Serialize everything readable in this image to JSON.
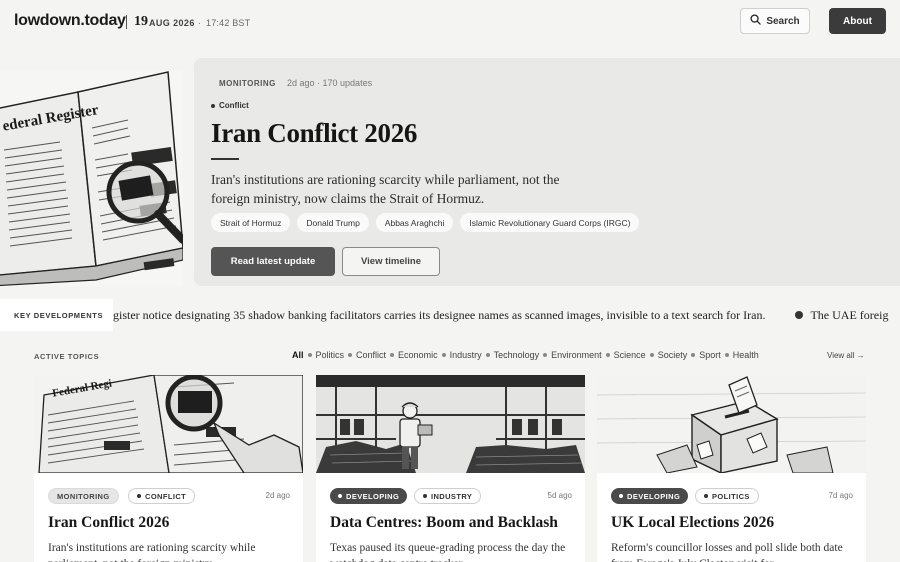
{
  "header": {
    "logo": "lowdown.today",
    "date_day": "19",
    "date_rest": "AUG 2026",
    "separator_dot": "·",
    "time": "17:42 BST",
    "search_label": "Search",
    "about_label": "About"
  },
  "hero": {
    "status": "MONITORING",
    "meta": "2d ago · 170 updates",
    "category": "Conflict",
    "title": "Iran Conflict 2026",
    "description": "Iran's institutions are rationing scarcity while parliament, not the foreign ministry, now claims the Strait of Hormuz.",
    "tags": [
      "Strait of Hormuz",
      "Donald Trump",
      "Abbas Araghchi",
      "Islamic Revolutionary Guard Corps (IRGC)"
    ],
    "primary_button": "Read latest update",
    "secondary_button": "View timeline"
  },
  "ticker": {
    "label": "KEY DEVELOPMENTS",
    "items": [
      "gister notice designating 35 shadow banking facilitators carries its designee names as scanned images, invisible to a text search for Iran.",
      "The UAE foreig"
    ]
  },
  "topics": {
    "label": "ACTIVE TOPICS",
    "filters": [
      "All",
      "Politics",
      "Conflict",
      "Economic",
      "Industry",
      "Technology",
      "Environment",
      "Science",
      "Society",
      "Sport",
      "Health"
    ],
    "active_filter": "All",
    "view_all": "View all →",
    "cards": [
      {
        "status": "MONITORING",
        "category": "CONFLICT",
        "age": "2d ago",
        "title": "Iran Conflict 2026",
        "description": "Iran's institutions are rationing scarcity while parliament, not the foreign ministry..."
      },
      {
        "status": "DEVELOPING",
        "category": "INDUSTRY",
        "age": "5d ago",
        "title": "Data Centres: Boom and Backlash",
        "description": "Texas paused its queue-grading process the day the watchdog data centre tracker..."
      },
      {
        "status": "DEVELOPING",
        "category": "POLITICS",
        "age": "7d ago",
        "title": "UK Local Elections 2026",
        "description": "Reform's councillor losses and poll slide both date from Farage's July Clacton visit for..."
      }
    ]
  },
  "hero_image_text": "Federal Register",
  "colors": {
    "background": "#f4f4f3",
    "hero_card": "#e9e9e8",
    "dark_button": "#3b3b3b",
    "primary_button": "#555555",
    "badge_dark": "#4a4a4a"
  },
  "icons": {
    "search": "search-icon"
  }
}
